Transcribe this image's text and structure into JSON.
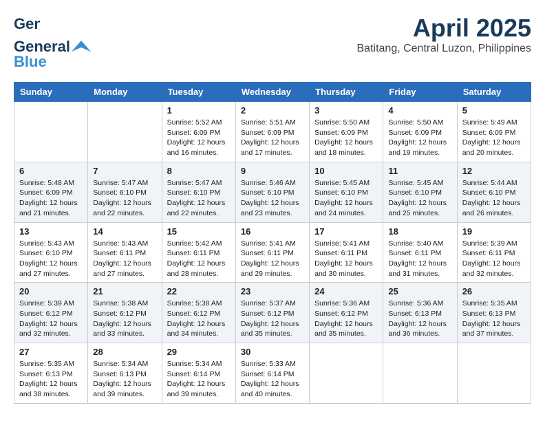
{
  "logo": {
    "line1": "General",
    "line2": "Blue"
  },
  "header": {
    "title": "April 2025",
    "subtitle": "Batitang, Central Luzon, Philippines"
  },
  "weekdays": [
    "Sunday",
    "Monday",
    "Tuesday",
    "Wednesday",
    "Thursday",
    "Friday",
    "Saturday"
  ],
  "weeks": [
    [
      {
        "day": null
      },
      {
        "day": null
      },
      {
        "day": "1",
        "sunrise": "5:52 AM",
        "sunset": "6:09 PM",
        "daylight": "12 hours and 16 minutes."
      },
      {
        "day": "2",
        "sunrise": "5:51 AM",
        "sunset": "6:09 PM",
        "daylight": "12 hours and 17 minutes."
      },
      {
        "day": "3",
        "sunrise": "5:50 AM",
        "sunset": "6:09 PM",
        "daylight": "12 hours and 18 minutes."
      },
      {
        "day": "4",
        "sunrise": "5:50 AM",
        "sunset": "6:09 PM",
        "daylight": "12 hours and 19 minutes."
      },
      {
        "day": "5",
        "sunrise": "5:49 AM",
        "sunset": "6:09 PM",
        "daylight": "12 hours and 20 minutes."
      }
    ],
    [
      {
        "day": "6",
        "sunrise": "5:48 AM",
        "sunset": "6:09 PM",
        "daylight": "12 hours and 21 minutes."
      },
      {
        "day": "7",
        "sunrise": "5:47 AM",
        "sunset": "6:10 PM",
        "daylight": "12 hours and 22 minutes."
      },
      {
        "day": "8",
        "sunrise": "5:47 AM",
        "sunset": "6:10 PM",
        "daylight": "12 hours and 22 minutes."
      },
      {
        "day": "9",
        "sunrise": "5:46 AM",
        "sunset": "6:10 PM",
        "daylight": "12 hours and 23 minutes."
      },
      {
        "day": "10",
        "sunrise": "5:45 AM",
        "sunset": "6:10 PM",
        "daylight": "12 hours and 24 minutes."
      },
      {
        "day": "11",
        "sunrise": "5:45 AM",
        "sunset": "6:10 PM",
        "daylight": "12 hours and 25 minutes."
      },
      {
        "day": "12",
        "sunrise": "5:44 AM",
        "sunset": "6:10 PM",
        "daylight": "12 hours and 26 minutes."
      }
    ],
    [
      {
        "day": "13",
        "sunrise": "5:43 AM",
        "sunset": "6:10 PM",
        "daylight": "12 hours and 27 minutes."
      },
      {
        "day": "14",
        "sunrise": "5:43 AM",
        "sunset": "6:11 PM",
        "daylight": "12 hours and 27 minutes."
      },
      {
        "day": "15",
        "sunrise": "5:42 AM",
        "sunset": "6:11 PM",
        "daylight": "12 hours and 28 minutes."
      },
      {
        "day": "16",
        "sunrise": "5:41 AM",
        "sunset": "6:11 PM",
        "daylight": "12 hours and 29 minutes."
      },
      {
        "day": "17",
        "sunrise": "5:41 AM",
        "sunset": "6:11 PM",
        "daylight": "12 hours and 30 minutes."
      },
      {
        "day": "18",
        "sunrise": "5:40 AM",
        "sunset": "6:11 PM",
        "daylight": "12 hours and 31 minutes."
      },
      {
        "day": "19",
        "sunrise": "5:39 AM",
        "sunset": "6:11 PM",
        "daylight": "12 hours and 32 minutes."
      }
    ],
    [
      {
        "day": "20",
        "sunrise": "5:39 AM",
        "sunset": "6:12 PM",
        "daylight": "12 hours and 32 minutes."
      },
      {
        "day": "21",
        "sunrise": "5:38 AM",
        "sunset": "6:12 PM",
        "daylight": "12 hours and 33 minutes."
      },
      {
        "day": "22",
        "sunrise": "5:38 AM",
        "sunset": "6:12 PM",
        "daylight": "12 hours and 34 minutes."
      },
      {
        "day": "23",
        "sunrise": "5:37 AM",
        "sunset": "6:12 PM",
        "daylight": "12 hours and 35 minutes."
      },
      {
        "day": "24",
        "sunrise": "5:36 AM",
        "sunset": "6:12 PM",
        "daylight": "12 hours and 35 minutes."
      },
      {
        "day": "25",
        "sunrise": "5:36 AM",
        "sunset": "6:13 PM",
        "daylight": "12 hours and 36 minutes."
      },
      {
        "day": "26",
        "sunrise": "5:35 AM",
        "sunset": "6:13 PM",
        "daylight": "12 hours and 37 minutes."
      }
    ],
    [
      {
        "day": "27",
        "sunrise": "5:35 AM",
        "sunset": "6:13 PM",
        "daylight": "12 hours and 38 minutes."
      },
      {
        "day": "28",
        "sunrise": "5:34 AM",
        "sunset": "6:13 PM",
        "daylight": "12 hours and 39 minutes."
      },
      {
        "day": "29",
        "sunrise": "5:34 AM",
        "sunset": "6:14 PM",
        "daylight": "12 hours and 39 minutes."
      },
      {
        "day": "30",
        "sunrise": "5:33 AM",
        "sunset": "6:14 PM",
        "daylight": "12 hours and 40 minutes."
      },
      {
        "day": null
      },
      {
        "day": null
      },
      {
        "day": null
      }
    ]
  ],
  "labels": {
    "sunrise": "Sunrise: ",
    "sunset": "Sunset: ",
    "daylight": "Daylight: "
  }
}
